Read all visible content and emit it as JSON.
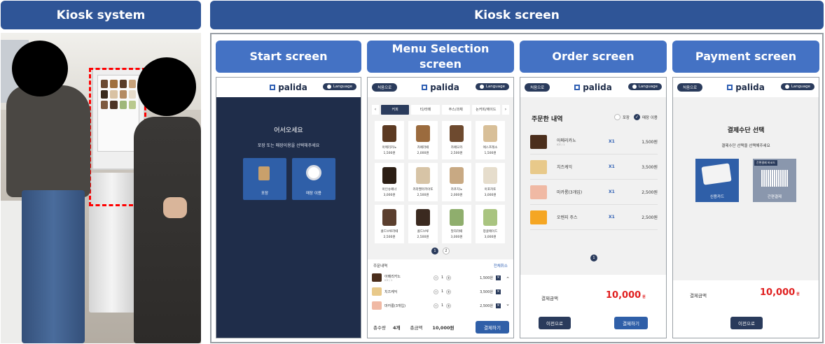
{
  "headers": {
    "kiosk_system": "Kiosk system",
    "kiosk_screen": "Kiosk screen"
  },
  "panels": {
    "start": "Start screen",
    "menu_line1": "Menu Selection",
    "menu_line2": "screen",
    "order": "Order screen",
    "payment": "Payment screen"
  },
  "common": {
    "brand": "palida",
    "language": "Language",
    "back_small": "처음으로"
  },
  "start": {
    "welcome": "어서오세요",
    "subtitle": "포장 또는 매장이용을 선택해주세요",
    "takeout": "포장",
    "dinein": "매장 이용"
  },
  "menu": {
    "tabs": [
      "커피",
      "티/라떼",
      "주스/과채",
      "논커피/에이드"
    ],
    "items": [
      {
        "name": "아메리카노",
        "price": "1,500원"
      },
      {
        "name": "카페라떼",
        "price": "2,000원"
      },
      {
        "name": "카페모카",
        "price": "2,500원"
      },
      {
        "name": "에스프레소",
        "price": "1,500원"
      },
      {
        "name": "아인슈페너",
        "price": "3,000원"
      },
      {
        "name": "카라멜마끼아또",
        "price": "2,500원"
      },
      {
        "name": "카푸치노",
        "price": "2,000원"
      },
      {
        "name": "아포카토",
        "price": "3,000원"
      },
      {
        "name": "콜드브루라떼",
        "price": "2,500원"
      },
      {
        "name": "콜드브루",
        "price": "2,500원"
      },
      {
        "name": "말차라떼",
        "price": "3,000원"
      },
      {
        "name": "청귤에이드",
        "price": "3,000원"
      }
    ],
    "pages": [
      "1",
      "2"
    ],
    "cart_title": "주문내역",
    "cart_clear": "전체취소",
    "cart": [
      {
        "name": "아메리카노",
        "sub": "ICE / 1",
        "qty": "1",
        "price": "1,500원"
      },
      {
        "name": "치즈케익",
        "sub": "",
        "qty": "1",
        "price": "3,500원"
      },
      {
        "name": "마카롱(3개입)",
        "sub": "",
        "qty": "1",
        "price": "2,500원"
      }
    ],
    "total_qty_label": "총수량",
    "total_qty": "4개",
    "total_label": "총금액",
    "total": "10,000원",
    "pay_button": "결제하기"
  },
  "order": {
    "title": "주문한 내역",
    "opt_takeout": "포장",
    "opt_dinein": "매장 이용",
    "rows": [
      {
        "name": "아메리카노",
        "sub": "ICE / 1",
        "qty": "X1",
        "price": "1,500원"
      },
      {
        "name": "치즈케익",
        "sub": "",
        "qty": "X1",
        "price": "3,500원"
      },
      {
        "name": "마카롱(3개입)",
        "sub": "",
        "qty": "X1",
        "price": "2,500원"
      },
      {
        "name": "오렌지 주스",
        "sub": "",
        "qty": "X1",
        "price": "2,500원"
      }
    ],
    "page": "1",
    "total_label": "결제금액",
    "total": "10,000",
    "won": "원",
    "prev": "이전으로",
    "pay": "결제하기"
  },
  "payment": {
    "title": "결제수단 선택",
    "subtitle": "결제수단 선택을 선택해주세요",
    "card": "신용카드",
    "simple_tag": "간편결제 바코드",
    "simple": "간편결제",
    "total_label": "결제금액",
    "total": "10,000",
    "won": "원",
    "prev": "이전으로"
  },
  "colors": {
    "header": "#2f5597",
    "subheader": "#4472c4",
    "navy": "#1f2d4a",
    "red": "#e02020",
    "dashed": "#ff0000"
  }
}
